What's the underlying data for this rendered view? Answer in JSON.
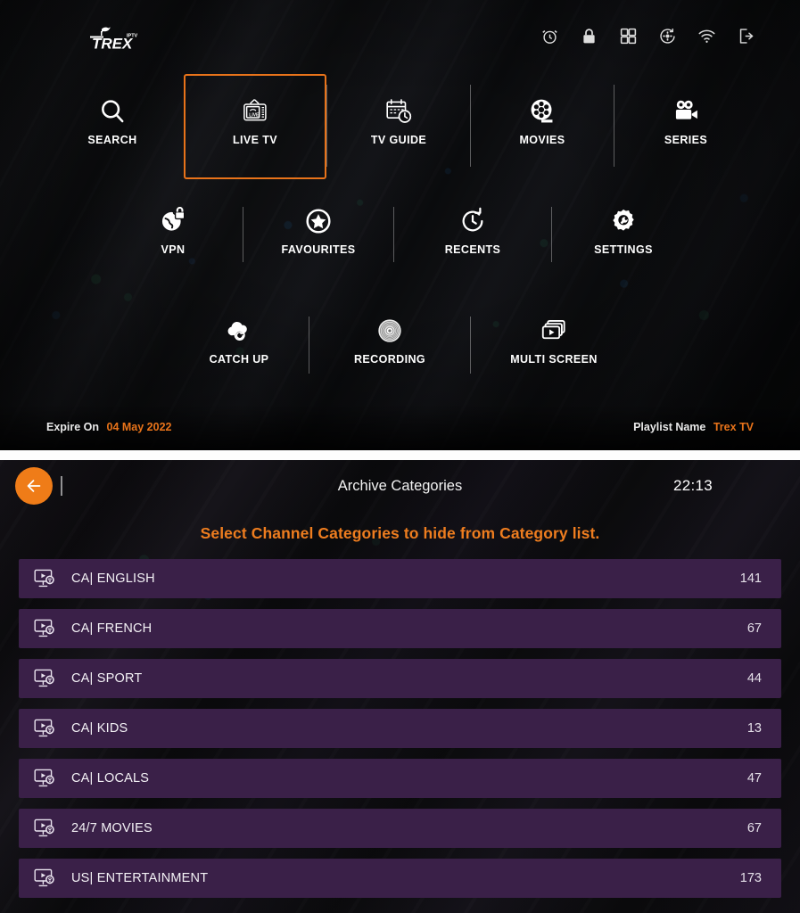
{
  "home": {
    "logo_text": "TREX",
    "logo_sup": "IPTV",
    "status_icons": [
      {
        "name": "alarm-clock-icon"
      },
      {
        "name": "lock-icon"
      },
      {
        "name": "apps-grid-icon"
      },
      {
        "name": "settings-refresh-icon"
      },
      {
        "name": "wifi-icon"
      },
      {
        "name": "logout-icon"
      }
    ],
    "nav_row_1": [
      {
        "label": "SEARCH",
        "icon": "search-icon",
        "focused": false
      },
      {
        "label": "LIVE TV",
        "icon": "live-tv-icon",
        "focused": true
      },
      {
        "label": "TV GUIDE",
        "icon": "tv-guide-icon",
        "focused": false
      },
      {
        "label": "MOVIES",
        "icon": "film-reel-icon",
        "focused": false
      },
      {
        "label": "SERIES",
        "icon": "video-camera-icon",
        "focused": false
      }
    ],
    "nav_row_2": [
      {
        "label": "VPN",
        "icon": "vpn-globe-lock-icon"
      },
      {
        "label": "FAVOURITES",
        "icon": "star-circle-icon"
      },
      {
        "label": "RECENTS",
        "icon": "clock-arrow-icon"
      },
      {
        "label": "SETTINGS",
        "icon": "gear-wrench-icon"
      }
    ],
    "nav_row_3": [
      {
        "label": "CATCH UP",
        "icon": "cloud-refresh-icon"
      },
      {
        "label": "RECORDING",
        "icon": "disc-icon"
      },
      {
        "label": "MULTI SCREEN",
        "icon": "multi-screen-icon"
      }
    ],
    "footer": {
      "expire_label": "Expire On",
      "expire_value": "04 May 2022",
      "playlist_label": "Playlist Name",
      "playlist_value": "Trex TV"
    }
  },
  "categories_screen": {
    "back_icon": "arrow-left-icon",
    "title": "Archive Categories",
    "clock": "22:13",
    "subtitle": "Select Channel Categories to hide from Category list.",
    "rows": [
      {
        "label": "CA| ENGLISH",
        "count": "141",
        "icon": "tv-play-icon"
      },
      {
        "label": "CA| FRENCH",
        "count": "67",
        "icon": "tv-play-icon"
      },
      {
        "label": "CA| SPORT",
        "count": "44",
        "icon": "tv-play-icon"
      },
      {
        "label": "CA| KIDS",
        "count": "13",
        "icon": "tv-play-icon"
      },
      {
        "label": "CA| LOCALS",
        "count": "47",
        "icon": "tv-play-icon"
      },
      {
        "label": "24/7 MOVIES",
        "count": "67",
        "icon": "tv-play-icon"
      },
      {
        "label": "US| ENTERTAINMENT",
        "count": "173",
        "icon": "tv-play-icon"
      }
    ]
  },
  "colors": {
    "accent_orange": "#ee7d1f",
    "focus_border": "#e8731a",
    "row_purple": "#3a2048",
    "panel_black": "#0b0b0e"
  }
}
